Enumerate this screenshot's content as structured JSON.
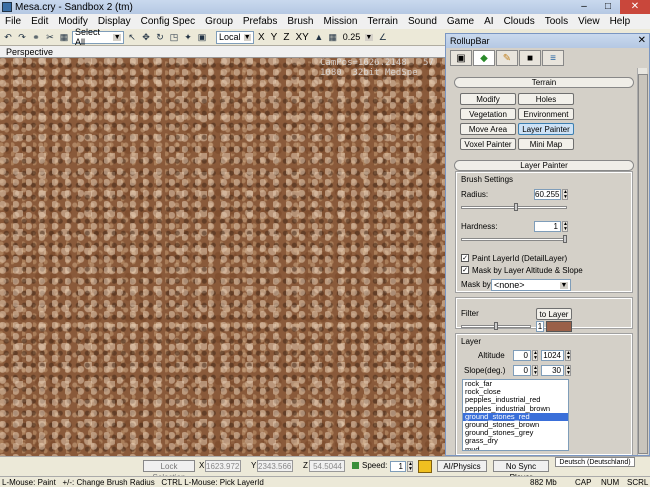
{
  "window": {
    "title": "Mesa.cry - Sandbox 2 (tm)"
  },
  "menu": [
    "File",
    "Edit",
    "Modify",
    "Display",
    "Config Spec",
    "Group",
    "Prefabs",
    "Brush",
    "Mission",
    "Terrain",
    "Sound",
    "Game",
    "AI",
    "Clouds",
    "Tools",
    "View",
    "Help"
  ],
  "toolbar": {
    "select_filter": "Select All",
    "coord_system": "Local",
    "axes": [
      "X",
      "Y",
      "Z",
      "XY"
    ],
    "grid_value": "0.25"
  },
  "viewport": {
    "label": "Perspective",
    "hud_lines": [
      "CamPos=1626.2148   57",
      "1080  32bit MedSpe"
    ]
  },
  "rollup": {
    "title": "RollupBar",
    "terrain_header": "Terrain",
    "tool_buttons": [
      "Modify",
      "Holes",
      "Vegetation",
      "Environment",
      "Move Area",
      "Layer Painter",
      "Voxel Painter",
      "Mini Map"
    ],
    "active_tool": "Layer Painter",
    "layer_painter_header": "Layer Painter",
    "brush_settings_label": "Brush Settings",
    "radius_label": "Radius:",
    "radius_value": "60.255",
    "radius_level": 0.52,
    "hardness_label": "Hardness:",
    "hardness_value": "1",
    "hardness_level": 1.0,
    "paint_layerid_label": "Paint LayerId (DetailLayer)",
    "paint_layerid_checked": true,
    "mask_altitude_label": "Mask by Layer Altitude & Slope",
    "mask_altitude_checked": true,
    "mask_by_label": "Mask by",
    "mask_by_value": "<none>",
    "filter_label": "Filter",
    "to_layer_label": "to Layer",
    "filter_value": "1",
    "filter_level": 0.5,
    "layer_label": "Layer",
    "altitude_label": "Altitude",
    "altitude_min": "0",
    "altitude_max": "1024",
    "slope_label": "Slope(deg.)",
    "slope_min": "0",
    "slope_max": "30",
    "layers": [
      "rock_far",
      "rock_close",
      "pepples_industrial_red",
      "pepples_industrial_brown",
      "ground_stones_red",
      "ground_stones_brown",
      "ground_stones_grey",
      "grass_dry",
      "mud"
    ],
    "selected_layer": "ground_stones_red",
    "layer_color": "#9a6048"
  },
  "bottom": {
    "lock_selection": "Lock Selection",
    "x_label": "X",
    "x_value": "1623.972",
    "y_label": "Y",
    "y_value": "2343.566",
    "z_label": "Z",
    "z_value": "54.5044",
    "speed_label": "Speed:",
    "speed_value": "1",
    "ai_physics": "AI/Physics",
    "no_sync": "No Sync Player",
    "language": "Deutsch (Deutschland)"
  },
  "status": {
    "hint": "L-Mouse: Paint   +/-: Change Brush Radius   CTRL L-Mouse: Pick LayerId",
    "memory": "882 Mb",
    "cap": "CAP",
    "num": "NUM",
    "scrl": "SCRL"
  }
}
